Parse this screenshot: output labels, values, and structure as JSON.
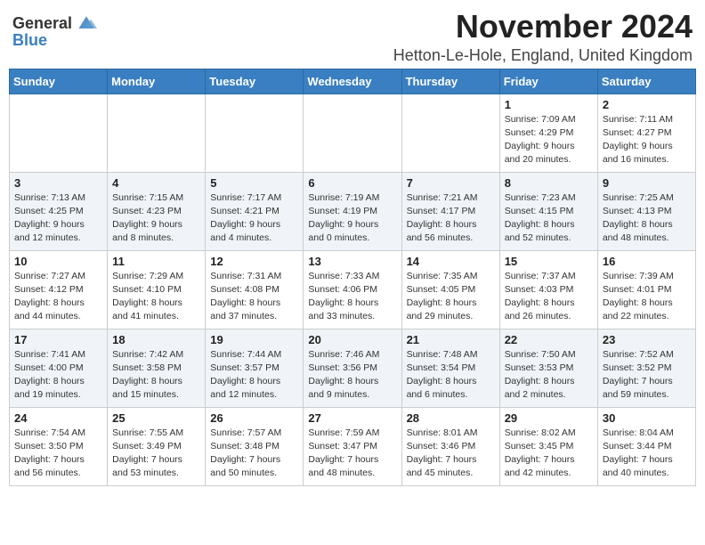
{
  "header": {
    "logo": {
      "general": "General",
      "blue": "Blue"
    },
    "month": "November 2024",
    "location": "Hetton-Le-Hole, England, United Kingdom"
  },
  "weekdays": [
    "Sunday",
    "Monday",
    "Tuesday",
    "Wednesday",
    "Thursday",
    "Friday",
    "Saturday"
  ],
  "weeks": [
    [
      {
        "day": "",
        "info": ""
      },
      {
        "day": "",
        "info": ""
      },
      {
        "day": "",
        "info": ""
      },
      {
        "day": "",
        "info": ""
      },
      {
        "day": "",
        "info": ""
      },
      {
        "day": "1",
        "info": "Sunrise: 7:09 AM\nSunset: 4:29 PM\nDaylight: 9 hours\nand 20 minutes."
      },
      {
        "day": "2",
        "info": "Sunrise: 7:11 AM\nSunset: 4:27 PM\nDaylight: 9 hours\nand 16 minutes."
      }
    ],
    [
      {
        "day": "3",
        "info": "Sunrise: 7:13 AM\nSunset: 4:25 PM\nDaylight: 9 hours\nand 12 minutes."
      },
      {
        "day": "4",
        "info": "Sunrise: 7:15 AM\nSunset: 4:23 PM\nDaylight: 9 hours\nand 8 minutes."
      },
      {
        "day": "5",
        "info": "Sunrise: 7:17 AM\nSunset: 4:21 PM\nDaylight: 9 hours\nand 4 minutes."
      },
      {
        "day": "6",
        "info": "Sunrise: 7:19 AM\nSunset: 4:19 PM\nDaylight: 9 hours\nand 0 minutes."
      },
      {
        "day": "7",
        "info": "Sunrise: 7:21 AM\nSunset: 4:17 PM\nDaylight: 8 hours\nand 56 minutes."
      },
      {
        "day": "8",
        "info": "Sunrise: 7:23 AM\nSunset: 4:15 PM\nDaylight: 8 hours\nand 52 minutes."
      },
      {
        "day": "9",
        "info": "Sunrise: 7:25 AM\nSunset: 4:13 PM\nDaylight: 8 hours\nand 48 minutes."
      }
    ],
    [
      {
        "day": "10",
        "info": "Sunrise: 7:27 AM\nSunset: 4:12 PM\nDaylight: 8 hours\nand 44 minutes."
      },
      {
        "day": "11",
        "info": "Sunrise: 7:29 AM\nSunset: 4:10 PM\nDaylight: 8 hours\nand 41 minutes."
      },
      {
        "day": "12",
        "info": "Sunrise: 7:31 AM\nSunset: 4:08 PM\nDaylight: 8 hours\nand 37 minutes."
      },
      {
        "day": "13",
        "info": "Sunrise: 7:33 AM\nSunset: 4:06 PM\nDaylight: 8 hours\nand 33 minutes."
      },
      {
        "day": "14",
        "info": "Sunrise: 7:35 AM\nSunset: 4:05 PM\nDaylight: 8 hours\nand 29 minutes."
      },
      {
        "day": "15",
        "info": "Sunrise: 7:37 AM\nSunset: 4:03 PM\nDaylight: 8 hours\nand 26 minutes."
      },
      {
        "day": "16",
        "info": "Sunrise: 7:39 AM\nSunset: 4:01 PM\nDaylight: 8 hours\nand 22 minutes."
      }
    ],
    [
      {
        "day": "17",
        "info": "Sunrise: 7:41 AM\nSunset: 4:00 PM\nDaylight: 8 hours\nand 19 minutes."
      },
      {
        "day": "18",
        "info": "Sunrise: 7:42 AM\nSunset: 3:58 PM\nDaylight: 8 hours\nand 15 minutes."
      },
      {
        "day": "19",
        "info": "Sunrise: 7:44 AM\nSunset: 3:57 PM\nDaylight: 8 hours\nand 12 minutes."
      },
      {
        "day": "20",
        "info": "Sunrise: 7:46 AM\nSunset: 3:56 PM\nDaylight: 8 hours\nand 9 minutes."
      },
      {
        "day": "21",
        "info": "Sunrise: 7:48 AM\nSunset: 3:54 PM\nDaylight: 8 hours\nand 6 minutes."
      },
      {
        "day": "22",
        "info": "Sunrise: 7:50 AM\nSunset: 3:53 PM\nDaylight: 8 hours\nand 2 minutes."
      },
      {
        "day": "23",
        "info": "Sunrise: 7:52 AM\nSunset: 3:52 PM\nDaylight: 7 hours\nand 59 minutes."
      }
    ],
    [
      {
        "day": "24",
        "info": "Sunrise: 7:54 AM\nSunset: 3:50 PM\nDaylight: 7 hours\nand 56 minutes."
      },
      {
        "day": "25",
        "info": "Sunrise: 7:55 AM\nSunset: 3:49 PM\nDaylight: 7 hours\nand 53 minutes."
      },
      {
        "day": "26",
        "info": "Sunrise: 7:57 AM\nSunset: 3:48 PM\nDaylight: 7 hours\nand 50 minutes."
      },
      {
        "day": "27",
        "info": "Sunrise: 7:59 AM\nSunset: 3:47 PM\nDaylight: 7 hours\nand 48 minutes."
      },
      {
        "day": "28",
        "info": "Sunrise: 8:01 AM\nSunset: 3:46 PM\nDaylight: 7 hours\nand 45 minutes."
      },
      {
        "day": "29",
        "info": "Sunrise: 8:02 AM\nSunset: 3:45 PM\nDaylight: 7 hours\nand 42 minutes."
      },
      {
        "day": "30",
        "info": "Sunrise: 8:04 AM\nSunset: 3:44 PM\nDaylight: 7 hours\nand 40 minutes."
      }
    ]
  ]
}
